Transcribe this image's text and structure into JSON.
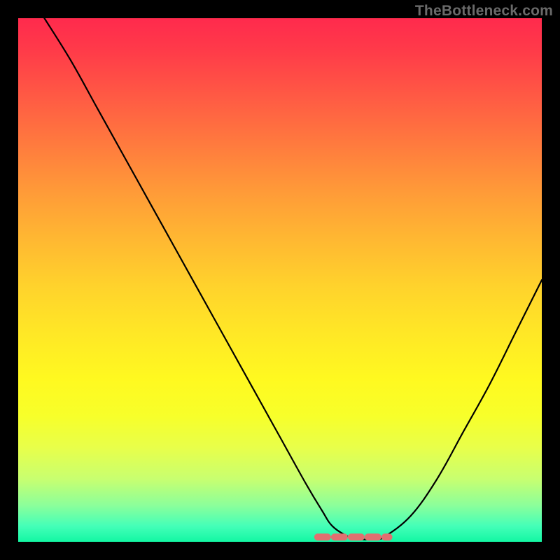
{
  "watermark": "TheBottleneck.com",
  "colors": {
    "frame": "#000000",
    "curve": "#000000",
    "dash": "#e07070"
  },
  "chart_data": {
    "type": "line",
    "title": "",
    "xlabel": "",
    "ylabel": "",
    "xlim": [
      0,
      100
    ],
    "ylim": [
      0,
      100
    ],
    "grid": false,
    "legend": false,
    "notes": "Qualitative bottleneck curve on a red-to-green vertical heat gradient; y is bottleneck severity (100 = worst, 0 = best). Values are estimated from pixel positions with no axis ticks shown.",
    "series": [
      {
        "name": "bottleneck_curve",
        "x": [
          5,
          10,
          15,
          20,
          25,
          30,
          35,
          40,
          45,
          50,
          55,
          58,
          60,
          63,
          65,
          68,
          70,
          75,
          80,
          85,
          90,
          95,
          100
        ],
        "y": [
          100,
          92,
          83,
          74,
          65,
          56,
          47,
          38,
          29,
          20,
          11,
          6,
          3,
          1,
          0.5,
          0.5,
          1,
          5,
          12,
          21,
          30,
          40,
          50
        ]
      }
    ],
    "flat_region": {
      "x_start": 58,
      "x_end": 70,
      "y": 0.5
    }
  }
}
